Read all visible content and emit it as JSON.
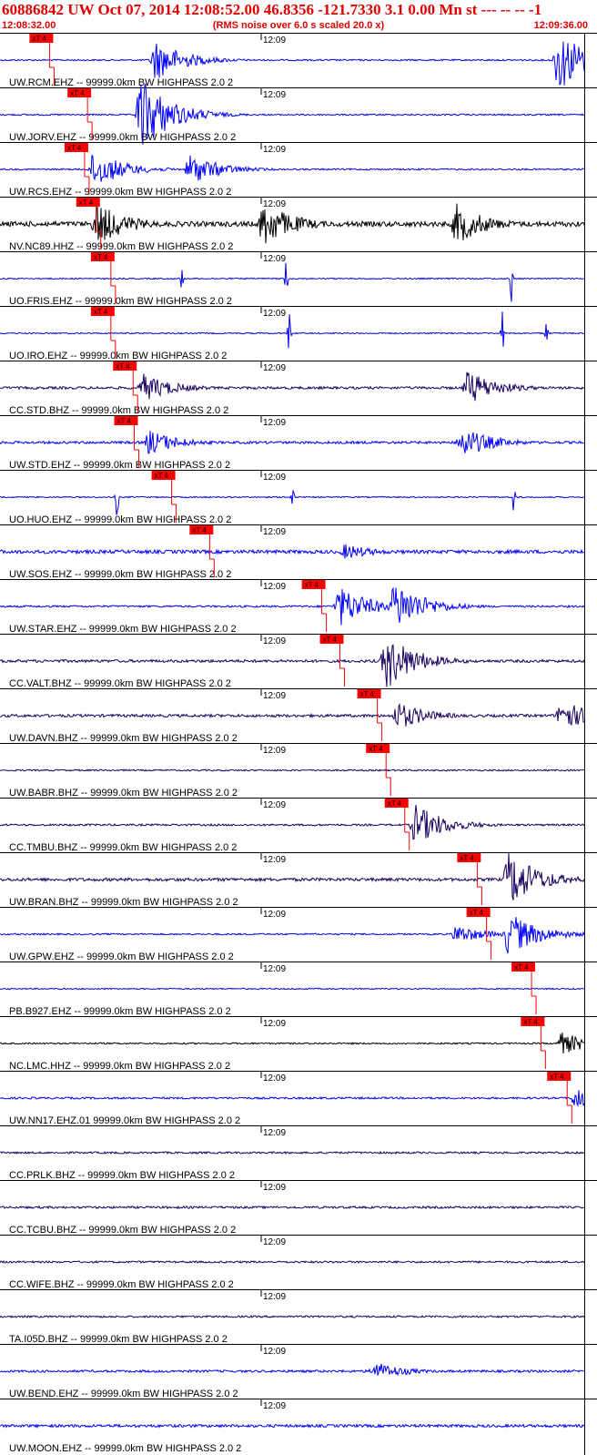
{
  "header": {
    "title": "60886842 UW Oct 07, 2014 12:08:52.00   46.8356 -121.7330  3.1 0.00 Mn st --- -- --  -1",
    "start_time": "12:08:32.00",
    "noise_note": "(RMS noise over 6.0 s scaled 20.0 x)",
    "end_time": "12:09:36.00"
  },
  "pick_label": "xT 4",
  "chart_data": {
    "type": "line",
    "x_range": [
      "12:08:32.00",
      "12:09:36.00"
    ],
    "time_tick_label": "12:09",
    "colors": {
      "blue": "#0000ff",
      "black": "#000000",
      "purple": "#1a0060",
      "pick": "#ff0000"
    },
    "traces": [
      {
        "label": "UW.RCM.EHZ -- 99999.0km BW  HIGHPASS  2.0  2",
        "color": "blue",
        "pick": 0.091,
        "events": [
          [
            0.265,
            1.3
          ],
          [
            0.955,
            2.0
          ]
        ],
        "noise": 0.12
      },
      {
        "label": "UW.JORV.EHZ -- 99999.0km BW  HIGHPASS  2.0  2",
        "color": "blue",
        "pick": 0.156,
        "events": [
          [
            0.24,
            2.4
          ]
        ],
        "noise": 0.12
      },
      {
        "label": "UW.RCS.EHZ -- 99999.0km BW  HIGHPASS  2.0  2",
        "color": "blue",
        "pick": 0.151,
        "events": [
          [
            0.16,
            1.2
          ],
          [
            0.325,
            1.0
          ]
        ],
        "noise": 0.12
      },
      {
        "label": "NV.NC89.HHZ -- 99999.0km BW  HIGHPASS  2.0  2",
        "color": "black",
        "pick": 0.171,
        "events": [
          [
            0.165,
            1.4
          ],
          [
            0.45,
            1.5
          ],
          [
            0.78,
            1.3
          ]
        ],
        "noise": 0.4
      },
      {
        "label": "UO.FRIS.EHZ -- 99999.0km BW  HIGHPASS  2.0  2",
        "color": "blue",
        "pick": 0.196,
        "events": [
          [
            0.31,
            1.2
          ],
          [
            0.49,
            1.1
          ],
          [
            0.875,
            1.2
          ]
        ],
        "noise": 0.1,
        "spiky": true
      },
      {
        "label": "UO.IRO.EHZ -- 99999.0km BW  HIGHPASS  2.0  2",
        "color": "blue",
        "pick": 0.196,
        "events": [
          [
            0.495,
            1.2
          ],
          [
            0.86,
            1.0
          ],
          [
            0.935,
            0.8
          ]
        ],
        "noise": 0.1,
        "spiky": true
      },
      {
        "label": "CC.STD.BHZ -- 99999.0km BW  HIGHPASS  2.0  2",
        "color": "purple",
        "pick": 0.234,
        "events": [
          [
            0.245,
            0.9
          ],
          [
            0.8,
            1.1
          ]
        ],
        "noise": 0.2
      },
      {
        "label": "UW.STD.EHZ -- 99999.0km BW  HIGHPASS  2.0  2",
        "color": "blue",
        "pick": 0.236,
        "events": [
          [
            0.255,
            0.8
          ],
          [
            0.79,
            1.0
          ]
        ],
        "noise": 0.2
      },
      {
        "label": "UO.HUO.EHZ -- 99999.0km BW  HIGHPASS  2.0  2",
        "color": "blue",
        "pick": 0.3,
        "events": [
          [
            0.2,
            1.2
          ],
          [
            0.5,
            1.0
          ],
          [
            0.88,
            1.2
          ]
        ],
        "noise": 0.1,
        "spiky": true
      },
      {
        "label": "UW.SOS.EHZ -- 99999.0km BW  HIGHPASS  2.0  2",
        "color": "blue",
        "pick": 0.365,
        "events": [
          [
            0.59,
            0.5
          ]
        ],
        "noise": 0.28
      },
      {
        "label": "UW.STAR.EHZ -- 99999.0km BW  HIGHPASS  2.0  2",
        "color": "blue",
        "pick": 0.557,
        "events": [
          [
            0.58,
            1.3
          ],
          [
            0.675,
            1.6
          ]
        ],
        "noise": 0.15
      },
      {
        "label": "CC.VALT.BHZ -- 99999.0km BW  HIGHPASS  2.0  2",
        "color": "purple",
        "pick": 0.588,
        "events": [
          [
            0.66,
            1.8
          ]
        ],
        "noise": 0.22
      },
      {
        "label": "UW.DAVN.BHZ -- 99999.0km BW  HIGHPASS  2.0  2",
        "color": "purple",
        "pick": 0.652,
        "events": [
          [
            0.68,
            0.9
          ],
          [
            0.96,
            1.0
          ]
        ],
        "noise": 0.22
      },
      {
        "label": "UW.BABR.BHZ -- 99999.0km BW  HIGHPASS  2.0  2",
        "color": "purple",
        "pick": 0.667,
        "events": [],
        "noise": 0.12
      },
      {
        "label": "CC.TMBU.BHZ -- 99999.0km BW  HIGHPASS  2.0  2",
        "color": "purple",
        "pick": 0.699,
        "events": [
          [
            0.71,
            1.3
          ]
        ],
        "noise": 0.15
      },
      {
        "label": "UW.BRAN.BHZ -- 99999.0km BW  HIGHPASS  2.0  2",
        "color": "purple",
        "pick": 0.823,
        "events": [
          [
            0.87,
            1.8
          ]
        ],
        "noise": 0.25
      },
      {
        "label": "UW.GPW.EHZ -- 99999.0km BW  HIGHPASS  2.0  2",
        "color": "blue",
        "pick": 0.839,
        "events": [
          [
            0.78,
            0.6
          ],
          [
            0.87,
            1.4
          ]
        ],
        "noise": 0.12
      },
      {
        "label": "PB.B927.EHZ -- 99999.0km BW  HIGHPASS  2.0  2",
        "color": "blue",
        "pick": 0.916,
        "events": [],
        "noise": 0.1
      },
      {
        "label": "NC.LMC.HHZ -- 99999.0km BW  HIGHPASS  2.0  2",
        "color": "black",
        "pick": 0.932,
        "events": [
          [
            0.96,
            0.7
          ]
        ],
        "noise": 0.12
      },
      {
        "label": "UW.NN17.EHZ.01 99999.0km BW  HIGHPASS  2.0  2",
        "color": "blue",
        "pick": 0.977,
        "events": [
          [
            0.985,
            0.8
          ]
        ],
        "noise": 0.15
      },
      {
        "label": "CC.PRLK.BHZ -- 99999.0km BW  HIGHPASS  2.0  2",
        "color": "purple",
        "pick": null,
        "events": [],
        "noise": 0.15
      },
      {
        "label": "CC.TCBU.BHZ -- 99999.0km BW  HIGHPASS  2.0  2",
        "color": "purple",
        "pick": null,
        "events": [],
        "noise": 0.17
      },
      {
        "label": "CC.WIFE.BHZ -- 99999.0km BW  HIGHPASS  2.0  2",
        "color": "purple",
        "pick": null,
        "events": [],
        "noise": 0.15
      },
      {
        "label": "TA.I05D.BHZ -- 99999.0km BW  HIGHPASS  2.0  2",
        "color": "purple",
        "pick": null,
        "events": [],
        "noise": 0.15
      },
      {
        "label": "UW.BEND.EHZ -- 99999.0km BW  HIGHPASS  2.0  2",
        "color": "blue",
        "pick": null,
        "events": [
          [
            0.64,
            0.6
          ]
        ],
        "noise": 0.18
      },
      {
        "label": "UW.MOON.EHZ -- 99999.0km BW  HIGHPASS  2.0  2",
        "color": "blue",
        "pick": null,
        "events": [],
        "noise": 0.22
      }
    ]
  }
}
